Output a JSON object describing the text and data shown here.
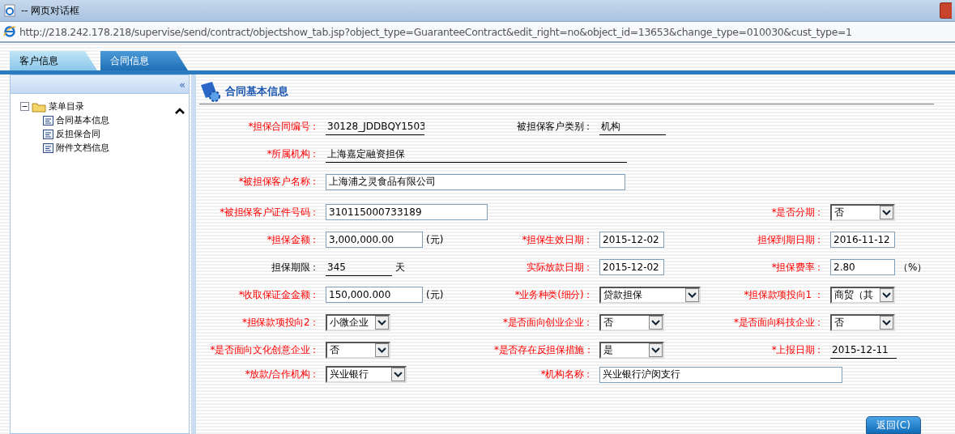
{
  "window": {
    "title": "-- 网页对话框"
  },
  "address_bar": {
    "url": "http://218.242.178.218/supervise/send/contract/objectshow_tab.jsp?object_type=GuaranteeContract&edit_right=no&object_id=13653&change_type=010030&cust_type=1"
  },
  "tabs": [
    {
      "label": "客户信息",
      "selected": false
    },
    {
      "label": "合同信息",
      "selected": true
    }
  ],
  "sidebar": {
    "collapse_glyph": "«",
    "tree": [
      {
        "label": "菜单目录",
        "expanded": true,
        "children": [
          {
            "label": "合同基本信息"
          },
          {
            "label": "反担保合同"
          },
          {
            "label": "附件文档信息"
          }
        ]
      }
    ]
  },
  "section": {
    "title": "合同基本信息"
  },
  "form_rows": [
    [
      {
        "label": "*担保合同编号：",
        "emphasized": true,
        "kind": "underline",
        "value": "30128_JDDBQY1503"
      },
      {
        "label": "被担保客户类别：",
        "emphasized": false,
        "kind": "underline",
        "value": "机构"
      }
    ],
    [
      {
        "label": "*所属机构：",
        "emphasized": true,
        "kind": "underline",
        "value": "上海嘉定融资担保"
      }
    ],
    [
      {
        "label": "*被担保客户名称：",
        "emphasized": true,
        "kind": "input",
        "value": "上海浦之灵食品有限公司"
      }
    ],
    [
      {
        "label": "*被担保客户证件号码：",
        "emphasized": true,
        "kind": "input",
        "value": "310115000733189"
      },
      {
        "label": "*是否分期：",
        "emphasized": true,
        "kind": "select",
        "value": "否"
      }
    ],
    [
      {
        "label": "*担保金额：",
        "emphasized": true,
        "kind": "input",
        "value": "3,000,000.00",
        "unit": "(元)"
      },
      {
        "label": "*担保生效日期：",
        "emphasized": true,
        "kind": "input",
        "value": "2015-12-02"
      },
      {
        "label": "担保到期日期：",
        "emphasized": true,
        "kind": "input",
        "value": "2016-11-12"
      }
    ],
    [
      {
        "label": "担保期限：",
        "emphasized": false,
        "kind": "underline",
        "value": "345",
        "unit": "天"
      },
      {
        "label": "实际放款日期：",
        "emphasized": true,
        "kind": "input",
        "value": "2015-12-02"
      },
      {
        "label": "*担保费率：",
        "emphasized": true,
        "kind": "input",
        "value": "2.80",
        "unit": "（%）"
      }
    ],
    [
      {
        "label": "*收取保证金金额：",
        "emphasized": true,
        "kind": "input",
        "value": "150,000.000",
        "unit": "(元)"
      },
      {
        "label": "*业务种类(细分)：",
        "emphasized": true,
        "kind": "select",
        "value": "贷款担保"
      },
      {
        "label": "*担保款项投向1 ：",
        "emphasized": true,
        "kind": "select",
        "value": "商贸（其"
      }
    ],
    [
      {
        "label": "*担保款项投向2：",
        "emphasized": true,
        "kind": "select",
        "value": "小微企业"
      },
      {
        "label": "*是否面向创业企业：",
        "emphasized": true,
        "kind": "select",
        "value": "否"
      },
      {
        "label": "*是否面向科技企业：",
        "emphasized": true,
        "kind": "select",
        "value": "否"
      }
    ],
    [
      {
        "label": "*是否面向文化创意企业：",
        "emphasized": true,
        "kind": "select",
        "value": "否"
      },
      {
        "label": "*是否存在反担保措施：",
        "emphasized": true,
        "kind": "select",
        "value": "是"
      },
      {
        "label": "*上报日期：",
        "emphasized": true,
        "kind": "underline",
        "value": "2015-12-11"
      }
    ],
    [
      {
        "label": "*放款/合作机构：",
        "emphasized": true,
        "kind": "select",
        "value": "兴业银行"
      },
      {
        "label": "*机构名称：",
        "emphasized": true,
        "kind": "input",
        "value": "兴业银行沪闵支行"
      }
    ]
  ],
  "buttons": [
    {
      "label": "返回(C)"
    }
  ]
}
